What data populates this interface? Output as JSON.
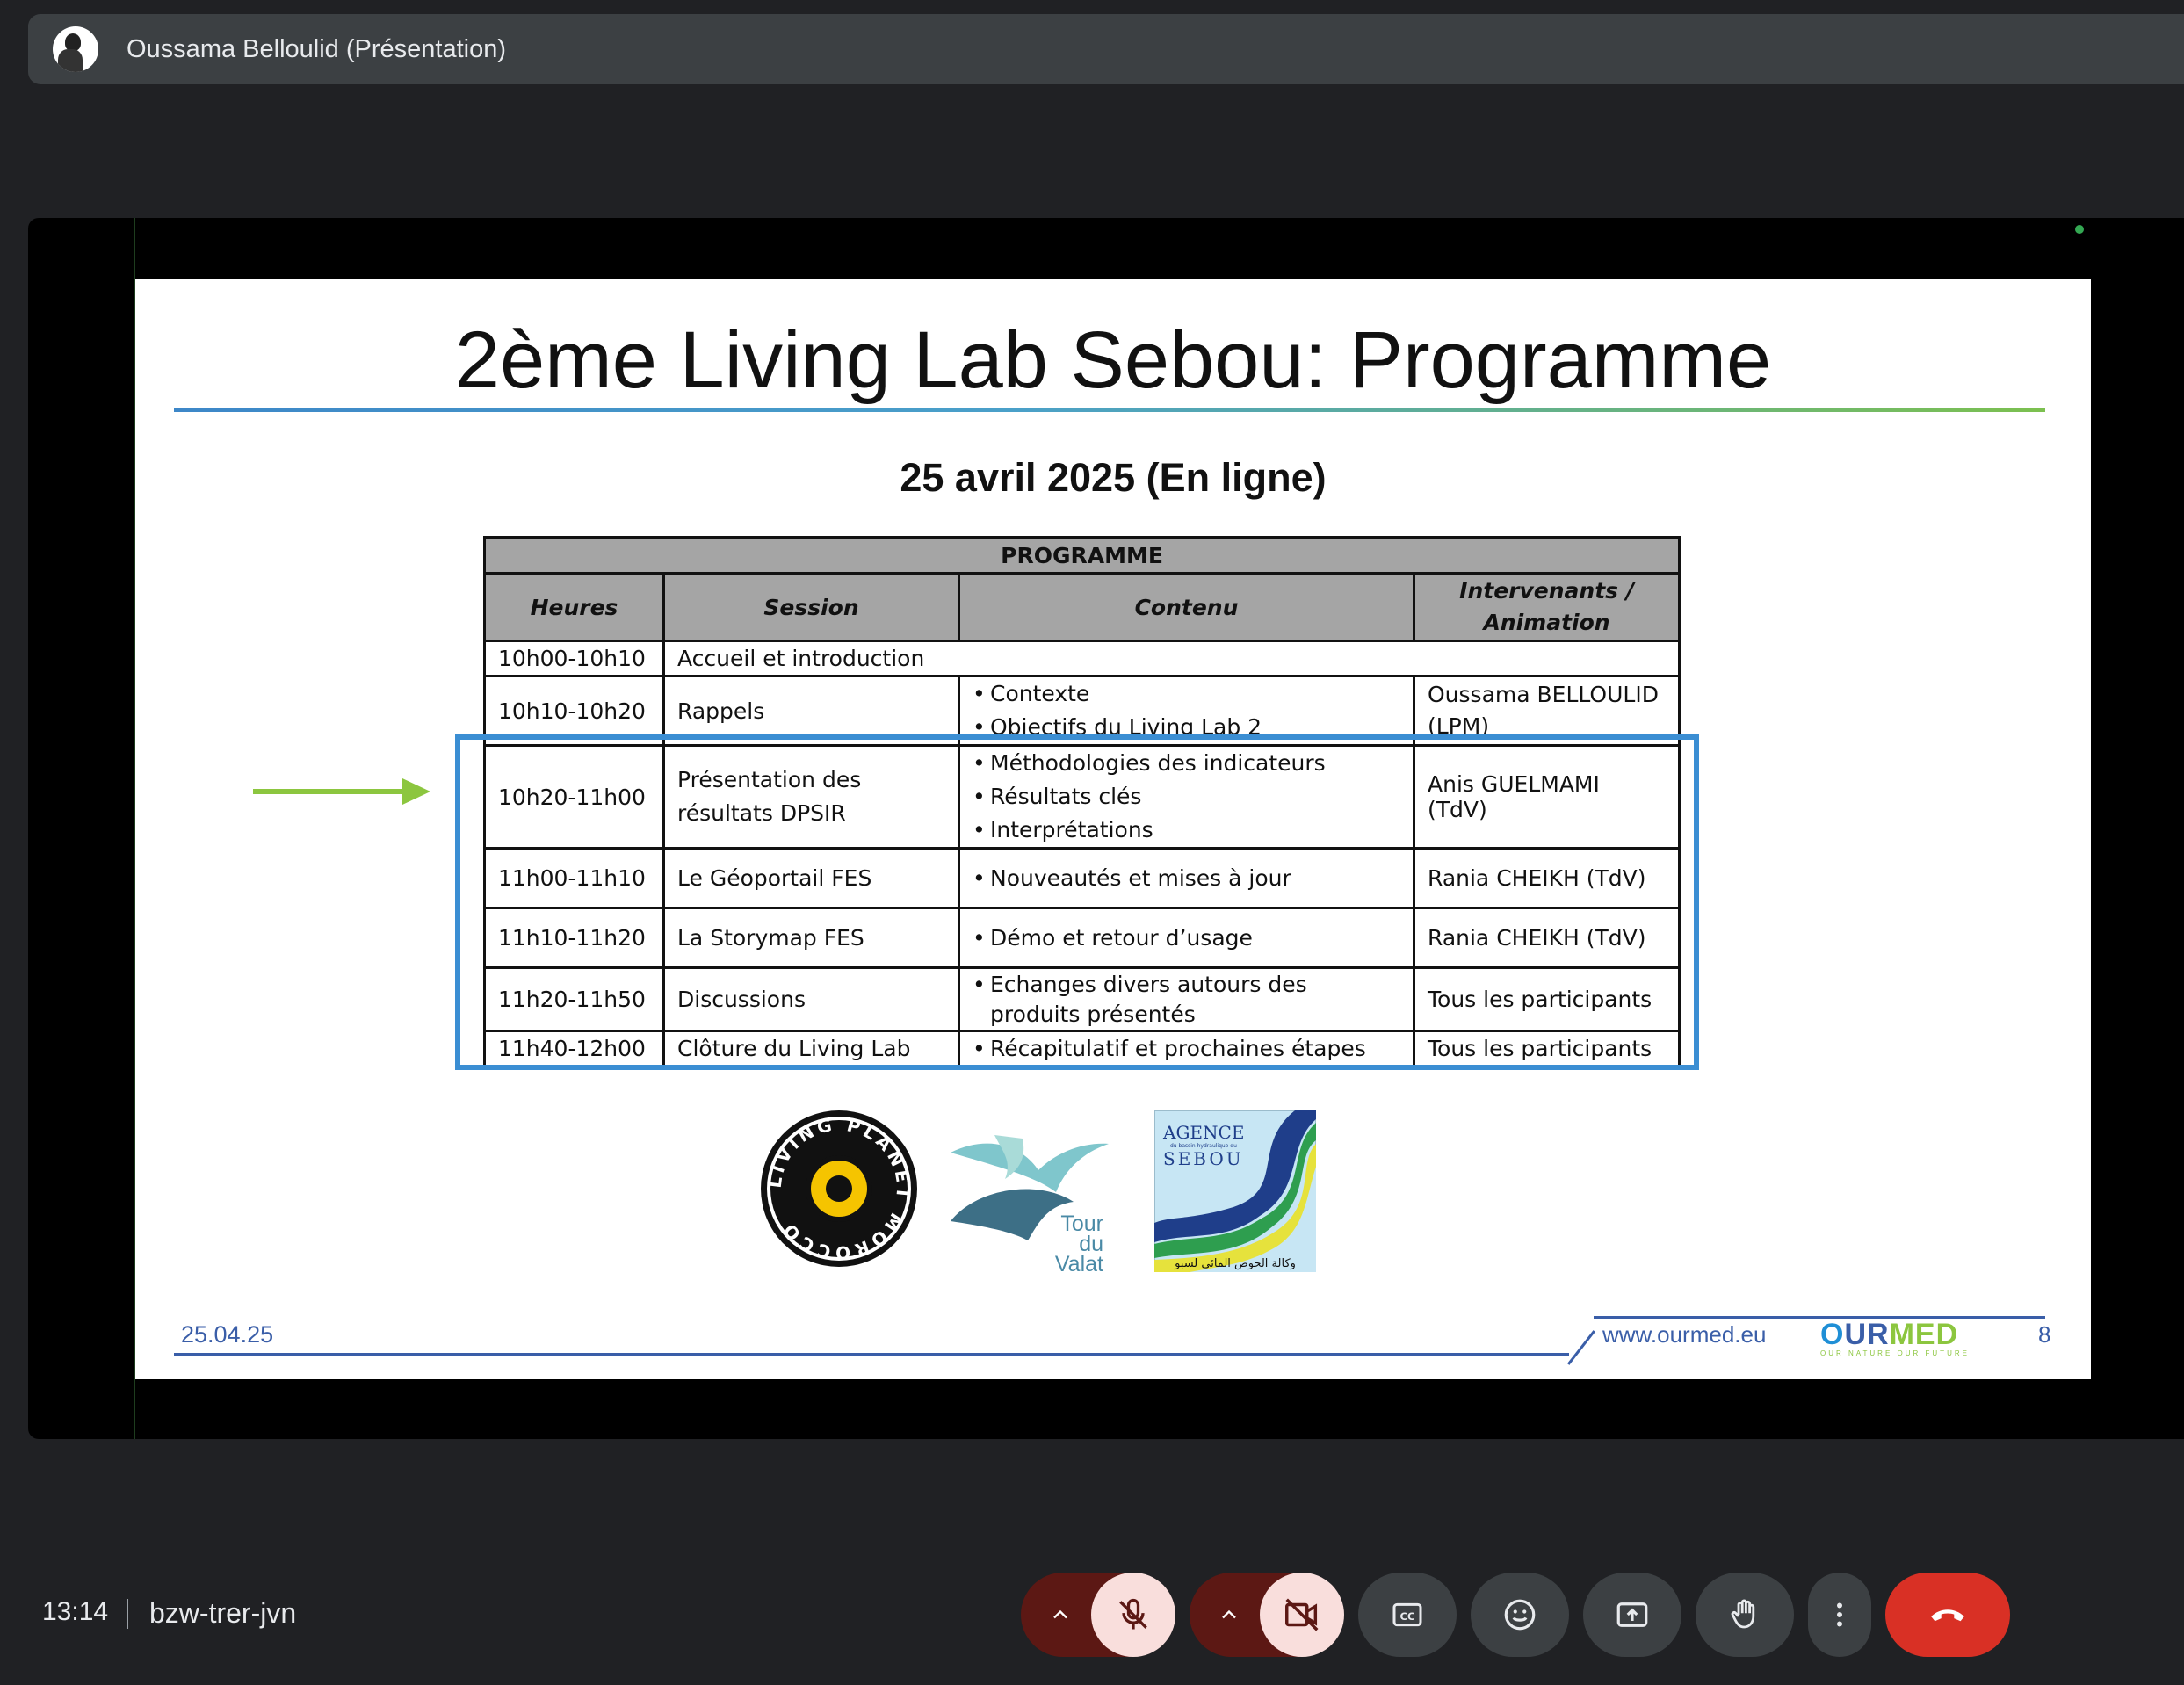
{
  "presenter": {
    "name": "Oussama Belloulid (Présentation)"
  },
  "slide": {
    "title": "2ème Living Lab Sebou: Programme",
    "date": "25 avril 2025 (En ligne)",
    "table": {
      "banner": "PROGRAMME",
      "headers": [
        "Heures",
        "Session",
        "Contenu",
        "Intervenants /\nAnimation"
      ],
      "rows": [
        {
          "time": "10h00-10h10",
          "session": "Accueil et introduction",
          "contenu": [],
          "intervenants": ""
        },
        {
          "time": "10h10-10h20",
          "session": "Rappels",
          "contenu": [
            "Contexte",
            "Objectifs du Living Lab 2"
          ],
          "intervenants": "Oussama BELLOULID (LPM)"
        },
        {
          "time": "10h20-11h00",
          "session": "Présentation des résultats DPSIR",
          "contenu": [
            "Méthodologies des indicateurs",
            "Résultats clés",
            "Interprétations"
          ],
          "intervenants": "Anis GUELMAMI (TdV)"
        },
        {
          "time": "11h00-11h10",
          "session": "Le Géoportail FES",
          "contenu": [
            "Nouveautés et mises à jour"
          ],
          "intervenants": "Rania CHEIKH (TdV)"
        },
        {
          "time": "11h10-11h20",
          "session": "La Storymap FES",
          "contenu": [
            "Démo et retour d’usage"
          ],
          "intervenants": "Rania CHEIKH (TdV)"
        },
        {
          "time": "11h20-11h50",
          "session": "Discussions",
          "contenu": [
            "Echanges divers autours des produits présentés"
          ],
          "intervenants": "Tous les participants"
        },
        {
          "time": "11h40-12h00",
          "session": "Clôture du Living Lab",
          "contenu": [
            "Récapitulatif et prochaines étapes"
          ],
          "intervenants": "Tous les participants"
        }
      ]
    },
    "logos": {
      "lpm_text": "LIVING PLANET MOROCCO",
      "tdv_text": [
        "Tour",
        "du",
        "Valat"
      ],
      "sebou_text": [
        "AGENCE",
        "du bassin hydraulique du",
        "SEBOU"
      ],
      "sebou_arabic": "وكالة الحوض المائي لسبو"
    },
    "footer": {
      "date": "25.04.25",
      "url": "www.ourmed.eu",
      "brand": {
        "o": "O",
        "ur": "UR",
        "med": "MED"
      },
      "tagline": "OUR NATURE  OUR FUTURE",
      "page": "8"
    }
  },
  "meeting": {
    "time": "13:14",
    "code": "bzw-trer-jvn"
  },
  "controls": [
    {
      "name": "mic-options",
      "icon": "chevron-up-icon"
    },
    {
      "name": "mic-toggle",
      "icon": "mic-off-icon"
    },
    {
      "name": "camera-options",
      "icon": "chevron-up-icon"
    },
    {
      "name": "camera-toggle",
      "icon": "videocam-off-icon"
    },
    {
      "name": "captions",
      "icon": "closed-caption-icon"
    },
    {
      "name": "reactions",
      "icon": "emoji-icon"
    },
    {
      "name": "present",
      "icon": "present-screen-icon"
    },
    {
      "name": "raise-hand",
      "icon": "hand-icon"
    },
    {
      "name": "more-options",
      "icon": "more-vert-icon"
    },
    {
      "name": "leave-call",
      "icon": "call-end-icon"
    }
  ],
  "colors": {
    "background": "#202124",
    "bar": "#3c4043",
    "mic_off_bg": "#f9dedc",
    "mic_off_dark": "#5c1814",
    "end_call": "#d93025",
    "highlight": "#3b8ed3",
    "arrow": "#8cc63f"
  }
}
